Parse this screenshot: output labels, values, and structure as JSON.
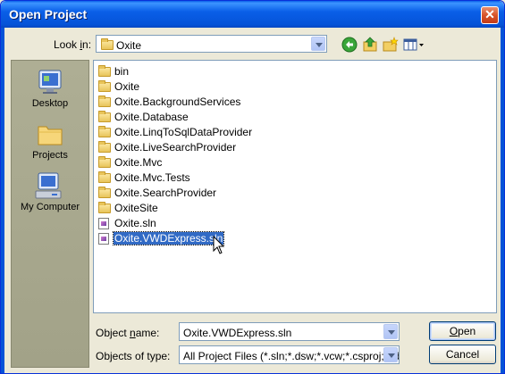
{
  "window": {
    "title": "Open Project",
    "close_glyph": "✕"
  },
  "look_in": {
    "label_prefix": "Look ",
    "label_accel": "i",
    "label_suffix": "n:",
    "value": "Oxite"
  },
  "toolbar": {
    "icons": [
      "back-icon",
      "up-folder-icon",
      "new-folder-icon",
      "views-menu-icon"
    ]
  },
  "places": [
    {
      "label": "Desktop",
      "icon": "desktop-icon"
    },
    {
      "label": "Projects",
      "icon": "projects-folder-icon"
    },
    {
      "label": "My Computer",
      "icon": "my-computer-icon"
    }
  ],
  "files": [
    {
      "name": "bin",
      "type": "folder"
    },
    {
      "name": "Oxite",
      "type": "folder"
    },
    {
      "name": "Oxite.BackgroundServices",
      "type": "folder"
    },
    {
      "name": "Oxite.Database",
      "type": "folder"
    },
    {
      "name": "Oxite.LinqToSqlDataProvider",
      "type": "folder"
    },
    {
      "name": "Oxite.LiveSearchProvider",
      "type": "folder"
    },
    {
      "name": "Oxite.Mvc",
      "type": "folder"
    },
    {
      "name": "Oxite.Mvc.Tests",
      "type": "folder"
    },
    {
      "name": "Oxite.SearchProvider",
      "type": "folder"
    },
    {
      "name": "OxiteSite",
      "type": "folder"
    },
    {
      "name": "Oxite.sln",
      "type": "solution"
    },
    {
      "name": "Oxite.VWDExpress.sln",
      "type": "solution",
      "selected": true
    }
  ],
  "object_name": {
    "label_prefix": "Object ",
    "label_accel": "n",
    "label_suffix": "ame:",
    "value": "Oxite.VWDExpress.sln"
  },
  "object_type": {
    "label": "Objects of type:",
    "value": "All Project Files (*.sln;*.dsw;*.vcw;*.csproj;*.vbp"
  },
  "buttons": {
    "open_accel": "O",
    "open_rest": "pen",
    "cancel": "Cancel"
  }
}
